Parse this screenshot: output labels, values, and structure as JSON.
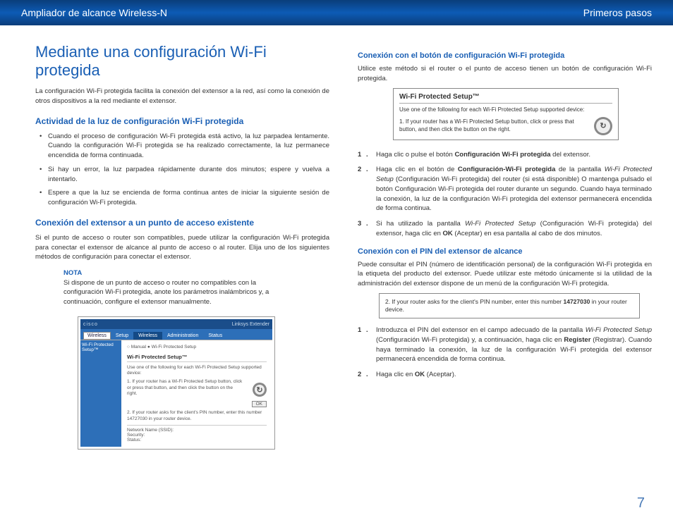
{
  "header": {
    "left": "Ampliador de alcance Wireless-N",
    "right": "Primeros pasos"
  },
  "left": {
    "h1": "Mediante una configuración Wi-Fi protegida",
    "intro": "La configuración Wi-Fi protegida facilita la conexión del extensor a la red, así como la conexión de otros dispositivos a la red mediante el extensor.",
    "h2a": "Actividad de la luz de configuración Wi-Fi protegida",
    "bullets": [
      "Cuando el proceso de configuración Wi-Fi protegida está activo, la luz parpadea lentamente. Cuando la configuración Wi-Fi protegida se ha realizado correctamente, la luz permanece encendida de forma continuada.",
      "Si hay un error, la luz parpadea rápidamente durante dos minutos; espere y vuelva a intentarlo.",
      "Espere a que la luz se encienda de forma continua antes de iniciar la siguiente sesión de configuración Wi-Fi protegida."
    ],
    "h2b": "Conexión del extensor a un punto de acceso existente",
    "p2": "Si el punto de acceso o router son compatibles, puede utilizar la configuración Wi-Fi protegida para conectar el extensor de alcance al punto de acceso o al router. Elija uno de los siguientes métodos de configuración para conectar el extensor.",
    "note": {
      "label": "NOTA",
      "body": "Si dispone de un punto de acceso o router no compatibles con la configuración Wi-Fi protegida, anote los parámetros inalámbricos y, a continuación, configure el extensor manualmente."
    },
    "ui": {
      "brand": "cisco",
      "product": "Linksys Extender",
      "sideLabel": "Wireless",
      "sideItem": "Wi-Fi Protected Setup™",
      "tabs": [
        "Setup",
        "Wireless",
        "Administration",
        "Status"
      ],
      "radio": "○ Manual  ● Wi-Fi Protected Setup",
      "panelTitle": "Wi-Fi Protected Setup™",
      "panelSub": "Use one of the following for each Wi-Fi Protected Setup supported device:",
      "step1": "1. If your router has a Wi-Fi Protected Setup button, click or press that button, and then click the button on the right.",
      "step2": "2. If your router asks for the client's PIN number, enter this number 14727030 in your router device.",
      "ok": "OK",
      "footerLabels": "Network Name (SSID):\nSecurity:",
      "footerStatus": "Status:"
    }
  },
  "right": {
    "h3a": "Conexión con el botón de configuración Wi-Fi protegida",
    "p1": "Utilice este método si el router o el punto de acceso tienen un botón de configuración Wi-Fi protegida.",
    "wps": {
      "title": "Wi-Fi Protected Setup™",
      "sub": "Use one of the following for each Wi-Fi Protected Setup supported device:",
      "step": "1. If your router has a Wi-Fi Protected Setup button, click or press that button, and then click the button on the right."
    },
    "ol1": [
      {
        "n": "1",
        "pre": "Haga clic o pulse el botón ",
        "b": "Configuración Wi-Fi protegida",
        "post": " del extensor."
      },
      {
        "n": "2",
        "pre": "Haga clic en el botón de ",
        "b": "Configuración-Wi-Fi protegida",
        "post": " de la pantalla ",
        "i": "Wi-Fi Protected Setup",
        "post2": " (Configuración Wi-Fi protegida) del router (si está disponible) O mantenga pulsado el botón Configuración Wi-Fi protegida del router durante un segundo. Cuando haya terminado la conexión, la luz de la configuración Wi-Fi protegida del extensor permanecerá encendida de forma continua."
      },
      {
        "n": "3",
        "pre": "Si ha utilizado la pantalla ",
        "i": "Wi-Fi Protected Setup",
        "mid": " (Configuración Wi-Fi protegida) del extensor, haga clic en ",
        "b": "OK",
        "post": " (Aceptar) en esa pantalla al cabo de dos minutos."
      }
    ],
    "h3b": "Conexión con el PIN del extensor de alcance",
    "p2": "Puede consultar el PIN (número de identificación personal) de la configuración Wi-Fi protegida en la etiqueta del producto del extensor. Puede utilizar este método únicamente si la utilidad de la administración del extensor dispone de un menú de la configuración Wi-Fi protegida.",
    "pinbox": {
      "pre": "2. If your router asks for the client's PIN number, enter this number ",
      "pin": "14727030",
      "post": " in your router device."
    },
    "ol2": [
      {
        "n": "1",
        "pre": "Introduzca el PIN del extensor en el campo adecuado de la pantalla ",
        "i": "Wi-Fi Protected Setup",
        "mid": " (Configuración Wi-Fi protegida) y, a continuación, haga clic en ",
        "b": "Register",
        "post": " (Registrar). Cuando haya terminado la conexión, la luz de la configuración Wi-Fi protegida del extensor permanecerá encendida de forma continua."
      },
      {
        "n": "2",
        "pre": "Haga clic en ",
        "b": "OK",
        "post": " (Aceptar)."
      }
    ]
  },
  "pageNumber": "7"
}
